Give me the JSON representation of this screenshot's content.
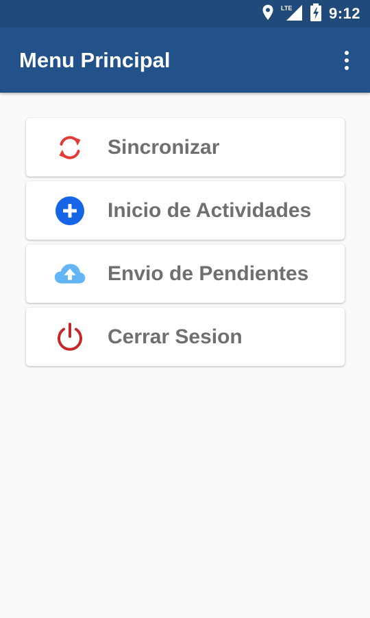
{
  "status_bar": {
    "time": "9:12",
    "network_label": "LTE",
    "icons": [
      "location-icon",
      "lte-signal-icon",
      "battery-charging-icon"
    ]
  },
  "app_bar": {
    "title": "Menu Principal",
    "overflow_icon": "more-vert-icon"
  },
  "menu": {
    "items": [
      {
        "label": "Sincronizar",
        "icon": "sync-icon",
        "color": "#e53935"
      },
      {
        "label": "Inicio de Actividades",
        "icon": "add-circle-icon",
        "color": "#1565e6"
      },
      {
        "label": "Envio de Pendientes",
        "icon": "cloud-upload-icon",
        "color": "#64b5f6"
      },
      {
        "label": "Cerrar Sesion",
        "icon": "power-icon",
        "color": "#c62828"
      }
    ]
  },
  "colors": {
    "status_bar": "#204a7a",
    "app_bar": "#23518a",
    "background": "#fafafa",
    "card": "#ffffff",
    "label_text": "#6f6f6f"
  }
}
